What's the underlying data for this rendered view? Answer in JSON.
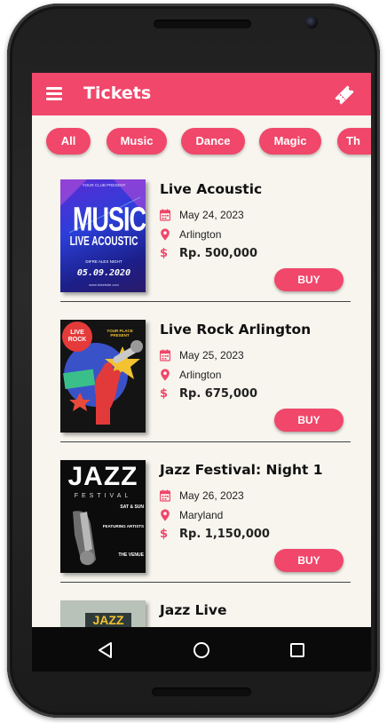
{
  "app": {
    "title": "Tickets",
    "accent_color": "#f0476a",
    "menu_icon": "hamburger-menu-icon",
    "action_icon": "ticket-icon"
  },
  "categories": [
    {
      "label": "All"
    },
    {
      "label": "Music"
    },
    {
      "label": "Dance"
    },
    {
      "label": "Magic"
    },
    {
      "label": "Th"
    }
  ],
  "events": [
    {
      "title": "Live Acoustic",
      "date": "May 24, 2023",
      "location": "Arlington",
      "price": "Rp. 500,000",
      "buy_label": "BUY",
      "poster": {
        "top_text": "YOUR CLUB PRESENT",
        "headline": "MUSIC",
        "subline": "LIVE ACOUSTIC",
        "names": "DIFRE   ALEX   NIGHT",
        "date": "05.09.2020",
        "footer": "www.ticketsite.com"
      }
    },
    {
      "title": "Live Rock Arlington",
      "date": "May 25, 2023",
      "location": "Arlington",
      "price": "Rp. 675,000",
      "buy_label": "BUY",
      "poster": {
        "badge": "LIVE ROCK",
        "top_text": "YOUR PLACE PRESENT"
      }
    },
    {
      "title": "Jazz Festival: Night 1",
      "date": "May 26, 2023",
      "location": "Maryland",
      "price": "Rp. 1,150,000",
      "buy_label": "BUY",
      "poster": {
        "headline": "JAZZ",
        "subline": "FESTIVAL",
        "days": "SAT & SUN",
        "featuring": "FEATURING ARTISTS",
        "venue": "THE VENUE"
      }
    },
    {
      "title": "Jazz Live",
      "poster": {
        "headline": "JAZZ"
      }
    }
  ],
  "icons": {
    "date": "calendar-icon",
    "location": "location-pin-icon",
    "price": "dollar-icon"
  },
  "navigation": {
    "back": "back-triangle-icon",
    "home": "home-circle-icon",
    "recents": "recents-square-icon"
  }
}
